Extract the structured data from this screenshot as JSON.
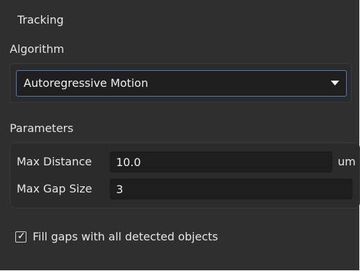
{
  "panel": {
    "title": "Tracking",
    "algorithm_label": "Algorithm",
    "algorithm_value": "Autoregressive Motion",
    "parameters_label": "Parameters",
    "max_distance_label": "Max Distance",
    "max_distance_value": "10.0",
    "max_distance_unit": "um",
    "max_gap_size_label": "Max Gap Size",
    "max_gap_size_value": "3",
    "fill_gaps_label": "Fill gaps with all detected objects",
    "fill_gaps_checked": true,
    "icons": {
      "dropdown": "chevron-down-icon",
      "check": "checkmark-icon"
    },
    "colors": {
      "panel_background": "#2f2f2f",
      "field_background": "#1e1e1e",
      "accent_border": "#4a7fbf",
      "text": "#e6e6e6"
    }
  }
}
